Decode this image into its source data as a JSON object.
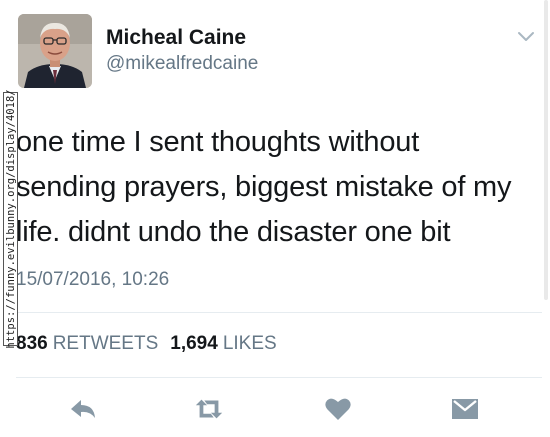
{
  "author": {
    "name": "Micheal Caine",
    "handle": "@mikealfredcaine"
  },
  "tweet": {
    "lines": [
      "one time I sent thoughts without",
      "sending prayers, biggest mistake of my",
      "life. didnt undo the disaster one bit"
    ],
    "timestamp": "15/07/2016, 10:26"
  },
  "stats": {
    "retweets_count": "836",
    "retweets_label": "RETWEETS",
    "likes_count": "1,694",
    "likes_label": "LIKES"
  },
  "actions": [
    {
      "icon": "reply-icon"
    },
    {
      "icon": "retweet-icon"
    },
    {
      "icon": "heart-icon"
    },
    {
      "icon": "direct-message-icon"
    }
  ],
  "watermark": "https://funny.evilbunny.org/display/4018/",
  "colors": {
    "text": "#14171a",
    "secondary": "#657786",
    "divider": "#e6ecf0",
    "icon": "#8899a6"
  }
}
